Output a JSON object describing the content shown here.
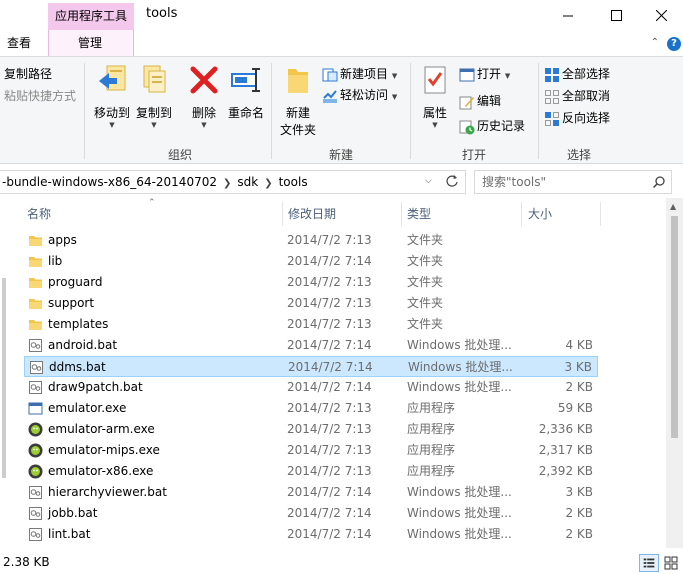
{
  "window": {
    "title": "tools",
    "context_tab_group": "应用程序工具",
    "tabs": [
      "查看",
      "管理"
    ],
    "controls": [
      "minimize-icon",
      "maximize-icon",
      "close-icon"
    ]
  },
  "ribbon": {
    "clipboard": {
      "copy_path": "复制路径",
      "paste_shortcut": "粘贴快捷方式"
    },
    "organize": {
      "label": "组织",
      "move_to": "移动到",
      "copy_to": "复制到",
      "delete": "删除",
      "rename": "重命名"
    },
    "new": {
      "label": "新建",
      "new_folder_line1": "新建",
      "new_folder_line2": "文件夹",
      "new_item": "新建项目",
      "easy_access": "轻松访问"
    },
    "open": {
      "label": "打开",
      "properties": "属性",
      "open": "打开",
      "edit": "编辑",
      "history": "历史记录"
    },
    "select": {
      "label": "选择",
      "select_all": "全部选择",
      "select_none": "全部取消",
      "invert": "反向选择"
    }
  },
  "address": {
    "segments": [
      "-bundle-windows-x86_64-20140702",
      "sdk",
      "tools"
    ],
    "search_placeholder": "搜索\"tools\""
  },
  "columns": {
    "name": "名称",
    "date": "修改日期",
    "type": "类型",
    "size": "大小"
  },
  "files": [
    {
      "name": "apps",
      "date": "2014/7/2 7:13",
      "type": "文件夹",
      "size": "",
      "icon": "folder-icon"
    },
    {
      "name": "lib",
      "date": "2014/7/2 7:14",
      "type": "文件夹",
      "size": "",
      "icon": "folder-icon"
    },
    {
      "name": "proguard",
      "date": "2014/7/2 7:13",
      "type": "文件夹",
      "size": "",
      "icon": "folder-icon"
    },
    {
      "name": "support",
      "date": "2014/7/2 7:13",
      "type": "文件夹",
      "size": "",
      "icon": "folder-icon"
    },
    {
      "name": "templates",
      "date": "2014/7/2 7:13",
      "type": "文件夹",
      "size": "",
      "icon": "folder-icon"
    },
    {
      "name": "android.bat",
      "date": "2014/7/2 7:14",
      "type": "Windows 批处理...",
      "size": "4 KB",
      "icon": "batch-file-icon"
    },
    {
      "name": "ddms.bat",
      "date": "2014/7/2 7:14",
      "type": "Windows 批处理...",
      "size": "3 KB",
      "icon": "batch-file-icon",
      "selected": true
    },
    {
      "name": "draw9patch.bat",
      "date": "2014/7/2 7:14",
      "type": "Windows 批处理...",
      "size": "2 KB",
      "icon": "batch-file-icon"
    },
    {
      "name": "emulator.exe",
      "date": "2014/7/2 7:13",
      "type": "应用程序",
      "size": "59 KB",
      "icon": "exe-window-icon"
    },
    {
      "name": "emulator-arm.exe",
      "date": "2014/7/2 7:13",
      "type": "应用程序",
      "size": "2,336 KB",
      "icon": "android-emulator-icon"
    },
    {
      "name": "emulator-mips.exe",
      "date": "2014/7/2 7:13",
      "type": "应用程序",
      "size": "2,317 KB",
      "icon": "android-emulator-icon"
    },
    {
      "name": "emulator-x86.exe",
      "date": "2014/7/2 7:13",
      "type": "应用程序",
      "size": "2,392 KB",
      "icon": "android-emulator-icon"
    },
    {
      "name": "hierarchyviewer.bat",
      "date": "2014/7/2 7:14",
      "type": "Windows 批处理...",
      "size": "3 KB",
      "icon": "batch-file-icon"
    },
    {
      "name": "jobb.bat",
      "date": "2014/7/2 7:14",
      "type": "Windows 批处理...",
      "size": "2 KB",
      "icon": "batch-file-icon"
    },
    {
      "name": "lint.bat",
      "date": "2014/7/2 7:14",
      "type": "Windows 批处理...",
      "size": "2 KB",
      "icon": "batch-file-icon"
    }
  ],
  "status": {
    "selection_size": "2.38 KB"
  },
  "colors": {
    "selection_bg": "#cce8ff",
    "selection_border": "#99d1ff",
    "context_tab": "#f4c7ec",
    "column_header": "#4c607a",
    "accent_blue": "#1a73c9"
  }
}
